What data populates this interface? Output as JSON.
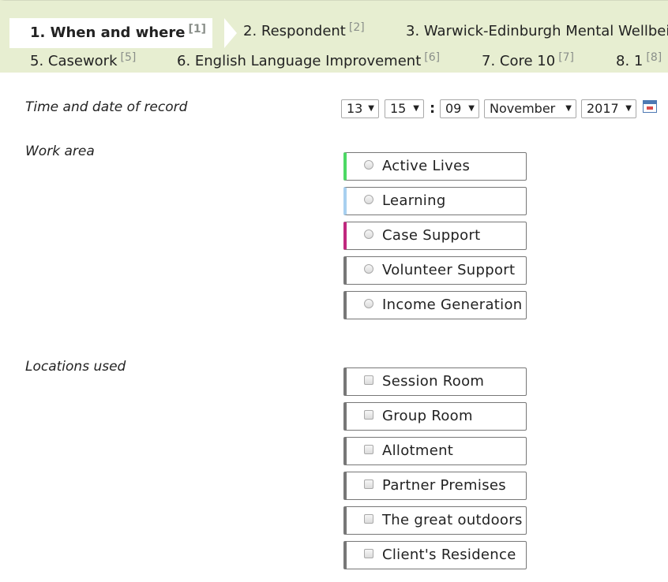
{
  "tabs": [
    {
      "label": "1. When and where",
      "ref": "[1]"
    },
    {
      "label": "2. Respondent",
      "ref": "[2]"
    },
    {
      "label": "3. Warwick-Edinburgh Mental Wellbei",
      "ref": ""
    },
    {
      "label": "5. Casework",
      "ref": "[5]"
    },
    {
      "label": "6. English Language Improvement",
      "ref": "[6]"
    },
    {
      "label": "7. Core 10",
      "ref": "[7]"
    },
    {
      "label": "8. 1",
      "ref": "[8]"
    }
  ],
  "time_date": {
    "label": "Time and date of record",
    "hour": "13",
    "minute": "15",
    "separator": ":",
    "day": "09",
    "month": "November",
    "year": "2017",
    "calendar_icon": "calendar-icon"
  },
  "work_area": {
    "label": "Work area",
    "options": [
      {
        "label": "Active Lives",
        "accent": "#4cd964"
      },
      {
        "label": "Learning",
        "accent": "#a8d0f0"
      },
      {
        "label": "Case Support",
        "accent": "#c0287e"
      },
      {
        "label": "Volunteer Support",
        "accent": "#777777"
      },
      {
        "label": "Income Generation",
        "accent": "#777777"
      }
    ]
  },
  "locations": {
    "label": "Locations used",
    "options": [
      {
        "label": "Session Room"
      },
      {
        "label": "Group Room"
      },
      {
        "label": "Allotment"
      },
      {
        "label": "Partner Premises"
      },
      {
        "label": "The great outdoors"
      },
      {
        "label": "Client's Residence"
      }
    ]
  },
  "colors": {
    "tab_bar": "#e7eed1",
    "option_border": "#777777",
    "calendar": "#4d79b3"
  }
}
